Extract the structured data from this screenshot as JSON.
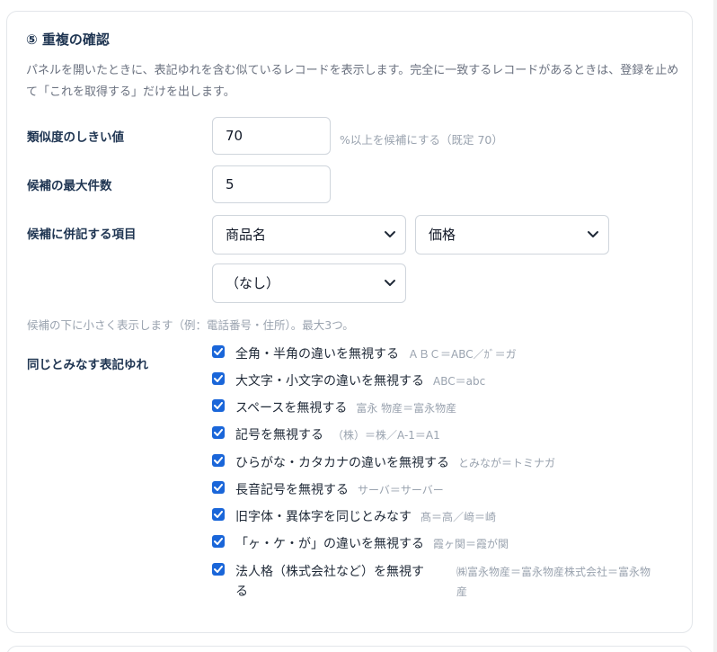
{
  "section": {
    "title": "⑤ 重複の確認",
    "description": "パネルを開いたときに、表記ゆれを含む似ているレコードを表示します。完全に一致するレコードがあるときは、登録を止めて「これを取得する」だけを出します。"
  },
  "similarity": {
    "label": "類似度のしきい値",
    "value": "70",
    "hint": "%以上を候補にする（既定 70）"
  },
  "max_candidates": {
    "label": "候補の最大件数",
    "value": "5"
  },
  "extra_fields": {
    "label": "候補に併記する項目",
    "selects": [
      "商品名",
      "価格",
      "（なし）"
    ],
    "note": "候補の下に小さく表示します（例：電話番号・住所）。最大3つ。"
  },
  "variations": {
    "label": "同じとみなす表記ゆれ",
    "items": [
      {
        "label": "全角・半角の違いを無視する",
        "example": "ＡＢＣ＝ABC／ｶﾞ＝ガ",
        "checked": true
      },
      {
        "label": "大文字・小文字の違いを無視する",
        "example": "ABC＝abc",
        "checked": true
      },
      {
        "label": "スペースを無視する",
        "example": "富永 物産＝富永物産",
        "checked": true
      },
      {
        "label": "記号を無視する",
        "example": "（株）＝株／A-1＝A1",
        "checked": true
      },
      {
        "label": "ひらがな・カタカナの違いを無視する",
        "example": "とみなが＝トミナガ",
        "checked": true
      },
      {
        "label": "長音記号を無視する",
        "example": "サーバ＝サーバー",
        "checked": true
      },
      {
        "label": "旧字体・異体字を同じとみなす",
        "example": "髙＝高／﨑＝崎",
        "checked": true
      },
      {
        "label": "「ヶ・ケ・が」の違いを無視する",
        "example": "霞ヶ関＝霞が関",
        "checked": true
      },
      {
        "label": "法人格（株式会社など）を無視す",
        "label2": "る",
        "example": "㈱富永物産＝富永物産株式会社＝富永物",
        "example2": "産",
        "checked": true
      }
    ]
  },
  "colors": {
    "accent": "#1a66d9",
    "heading": "#1f3552",
    "muted": "#9aa3af"
  }
}
